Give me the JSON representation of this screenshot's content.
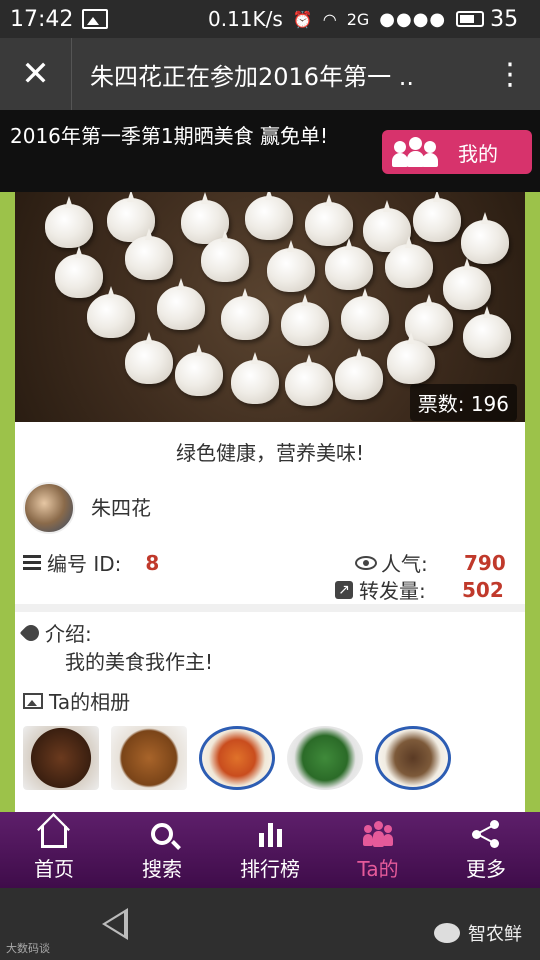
{
  "status_bar": {
    "time": "17:42",
    "speed": "0.11K/s",
    "signal_label_2g": "2G",
    "signal_dots": "●●●●",
    "battery": "35"
  },
  "title_bar": {
    "title": "朱四花正在参加2016年第一 .."
  },
  "banner": {
    "text": "2016年第一季第1期晒美食 赢免单!",
    "my_button": "我的"
  },
  "entry": {
    "votes": "票数: 196",
    "slogan": "绿色健康，营养美味!",
    "author": "朱四花",
    "id_label": "编号 ID:",
    "id_value": "8",
    "popularity_label": "人气:",
    "popularity_value": "790",
    "shares_label": "转发量:",
    "shares_value": "502",
    "intro_label": "介绍:",
    "intro_text": "我的美食我作主!",
    "album_label": "Ta的相册"
  },
  "bottom_nav": {
    "items": [
      {
        "label": "首页",
        "icon": "home-icon"
      },
      {
        "label": "搜索",
        "icon": "search-icon"
      },
      {
        "label": "排行榜",
        "icon": "ranking-icon"
      },
      {
        "label": "Ta的",
        "icon": "people-icon",
        "active": true
      },
      {
        "label": "更多",
        "icon": "share-icon"
      }
    ]
  },
  "system_bar": {
    "watermark_left": "大数码谈",
    "watermark_right": "智农鲜"
  },
  "colors": {
    "accent": "#d7336c",
    "value_red": "#c0392b",
    "nav_purple": "#5e1f6b"
  }
}
